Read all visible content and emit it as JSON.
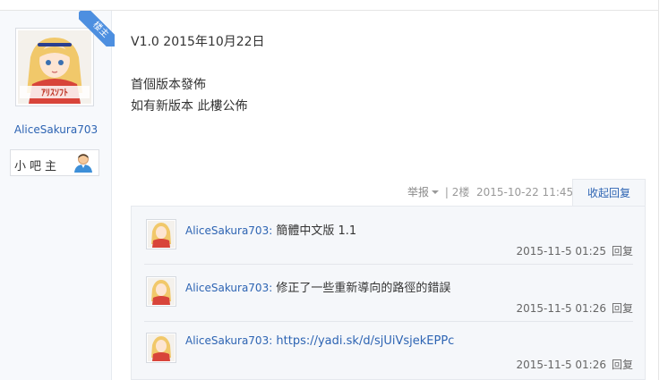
{
  "author": {
    "name": "AliceSakura703",
    "rank": "小吧主",
    "badge": "楼主"
  },
  "post": {
    "lines": [
      "V1.0 2015年10月22日",
      "",
      "首個版本發佈",
      "如有新版本 此樓公佈"
    ]
  },
  "tail": {
    "report": "举报",
    "separator": "|",
    "floor": "2楼",
    "time": "2015-10-22 11:45",
    "collapse": "收起回复"
  },
  "replies": [
    {
      "user": "AliceSakura703:",
      "text": " 簡體中文版 1.1",
      "time": "2015-11-5 01:25",
      "reply_label": "回复"
    },
    {
      "user": "AliceSakura703:",
      "text": " 修正了一些重新導向的路徑的錯誤",
      "time": "2015-11-5 01:26",
      "reply_label": "回复"
    },
    {
      "user": "AliceSakura703:",
      "text": " https://yadi.sk/d/sjUiVsjekEPPc",
      "time": "2015-11-5 01:26",
      "reply_label": "回复"
    }
  ],
  "colors": {
    "link": "#2d64b3",
    "ribbon": "#4d8fe0",
    "panel": "#f5f7fa"
  }
}
